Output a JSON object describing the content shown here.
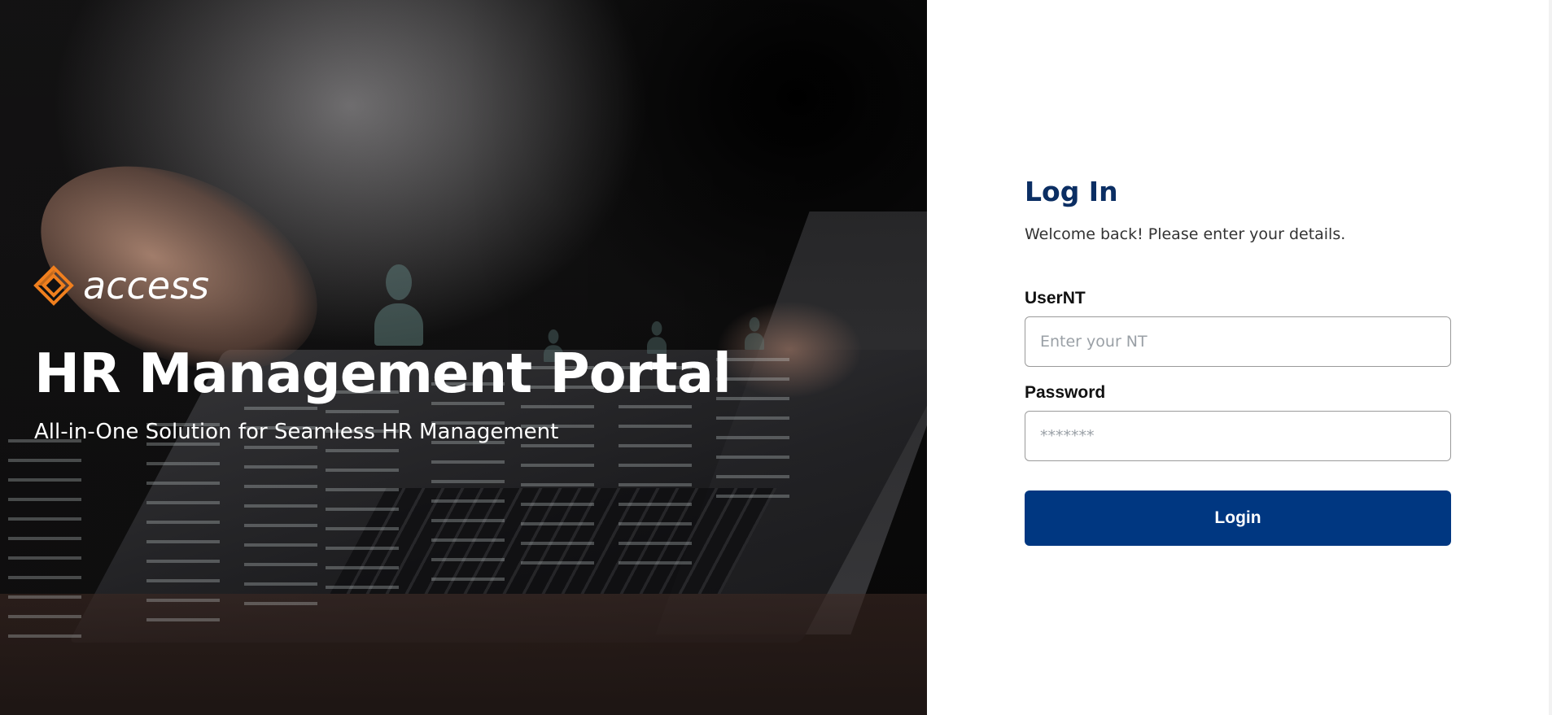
{
  "hero": {
    "brand_name": "access",
    "brand_logo_icon": "access-diamond-logo",
    "title": "HR Management Portal",
    "subtitle": "All-in-One Solution for Seamless HR Management"
  },
  "login": {
    "title": "Log In",
    "subtitle": "Welcome back! Please enter your details.",
    "user_label": "UserNT",
    "user_placeholder": "Enter your NT",
    "password_label": "Password",
    "password_placeholder": "*******",
    "button_label": "Login"
  },
  "colors": {
    "brand_orange": "#f07f1e",
    "primary_navy": "#003781",
    "title_navy": "#0b2e63"
  }
}
